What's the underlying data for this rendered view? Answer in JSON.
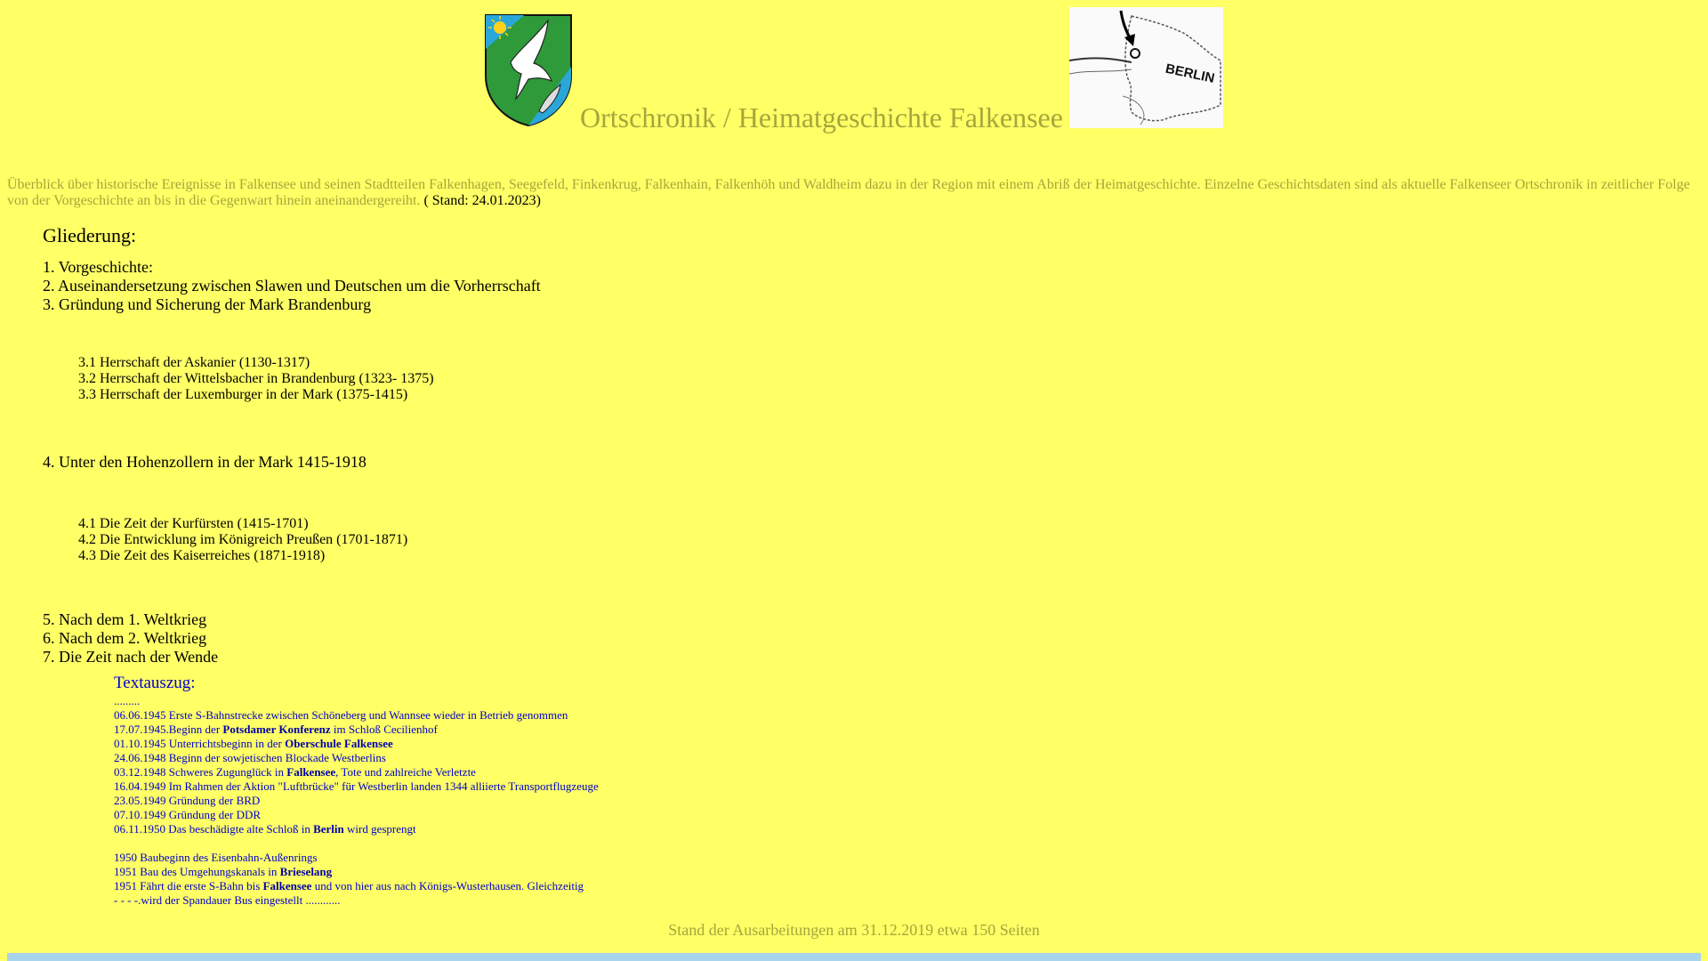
{
  "header": {
    "title": "Ortschronik / Heimatgeschichte Falkensee",
    "map_label": "BERLIN"
  },
  "intro": {
    "text": "Überblick über historische Ereignisse in Falkensee und seinen Stadtteilen Falkenhagen, Seegefeld, Finkenkrug, Falkenhain, Falkenhöh und Waldheim dazu in der Region mit einem Abriß der Heimatgeschichte. Einzelne Geschichtsdaten sind als aktuelle Falkenseer Ortschronik in zeitlicher Folge von der Vorgeschichte an bis in die Gegenwart hinein aneinandergereiht.",
    "stand": "( Stand: 24.01.2023)"
  },
  "toc": {
    "heading": "Gliederung:",
    "items": [
      "1. Vorgeschichte:",
      "2. Auseinandersetzung zwischen Slawen und Deutschen um die Vorherrschaft",
      "3. Gründung und Sicherung der Mark Brandenburg",
      "3.1 Herrschaft der Askanier (1130-1317)",
      "3.2 Herrschaft der Wittelsbacher in Brandenburg (1323- 1375)",
      "3.3 Herrschaft der Luxemburger in der Mark (1375-1415)",
      "4. Unter den Hohenzollern in der Mark 1415-1918",
      "4.1 Die Zeit der Kurfürsten (1415-1701)",
      "4.2 Die Entwicklung im Königreich Preußen (1701-1871)",
      "4.3 Die Zeit des Kaiserreiches (1871-1918)",
      "5. Nach dem 1. Weltkrieg",
      "6. Nach dem 2. Weltkrieg",
      "7. Die Zeit nach der Wende"
    ]
  },
  "excerpt": {
    "title": "Textauszug:",
    "dots": ".........",
    "lines": [
      {
        "pre": "06.06.1945 Erste S-Bahnstrecke zwischen Schöneberg und Wannsee wieder in Betrieb genommen",
        "bold": "",
        "post": ""
      },
      {
        "pre": "17.07.1945.Beginn der ",
        "bold": "Potsdamer Konferenz",
        "post": " im Schloß Cecilienhof"
      },
      {
        "pre": "01.10.1945 Unterrichtsbeginn in der ",
        "bold": "Oberschule Falkensee",
        "post": ""
      },
      {
        "pre": "24.06.1948 Beginn der sowjetischen Blockade Westberlins",
        "bold": "",
        "post": ""
      },
      {
        "pre": "03.12.1948 Schweres Zugunglück in ",
        "bold": "Falkensee",
        "post": ", Tote und zahlreiche Verletzte"
      },
      {
        "pre": "16.04.1949 Im Rahmen der Aktion \"Luftbrücke\" für Westberlin landen 1344 alliierte Transportflugzeuge",
        "bold": "",
        "post": ""
      },
      {
        "pre": "23.05.1949 Gründung der BRD",
        "bold": "",
        "post": ""
      },
      {
        "pre": "07.10.1949 Gründung der DDR",
        "bold": "",
        "post": ""
      },
      {
        "pre": "06.11.1950 Das beschädigte alte Schloß in ",
        "bold": "Berlin",
        "post": " wird gesprengt"
      },
      {
        "pre": "",
        "bold": "",
        "post": ""
      },
      {
        "pre": "1950 Baubeginn des Eisenbahn-Außenrings",
        "bold": "",
        "post": ""
      },
      {
        "pre": "1951 Bau des Umgehungskanals in ",
        "bold": "Brieselang",
        "post": ""
      },
      {
        "pre": "1951 Fährt die erste S-Bahn bis ",
        "bold": "Falkensee",
        "post": " und von hier aus nach Königs-Wusterhausen. Gleichzeitig"
      },
      {
        "pre": "- - - -.wird der Spandauer Bus eingestellt ............",
        "bold": "",
        "post": ""
      }
    ]
  },
  "footer": {
    "note": "Stand der Ausarbeitungen am 31.12.2019 etwa 150 Seiten"
  },
  "colors": {
    "background": "#ffff66",
    "olive_text": "#a6a63c",
    "link_blue": "#0000cc",
    "crest_green": "#2e9a3a",
    "crest_blue": "#2aa7d8",
    "bar": "#a9d4ee"
  }
}
